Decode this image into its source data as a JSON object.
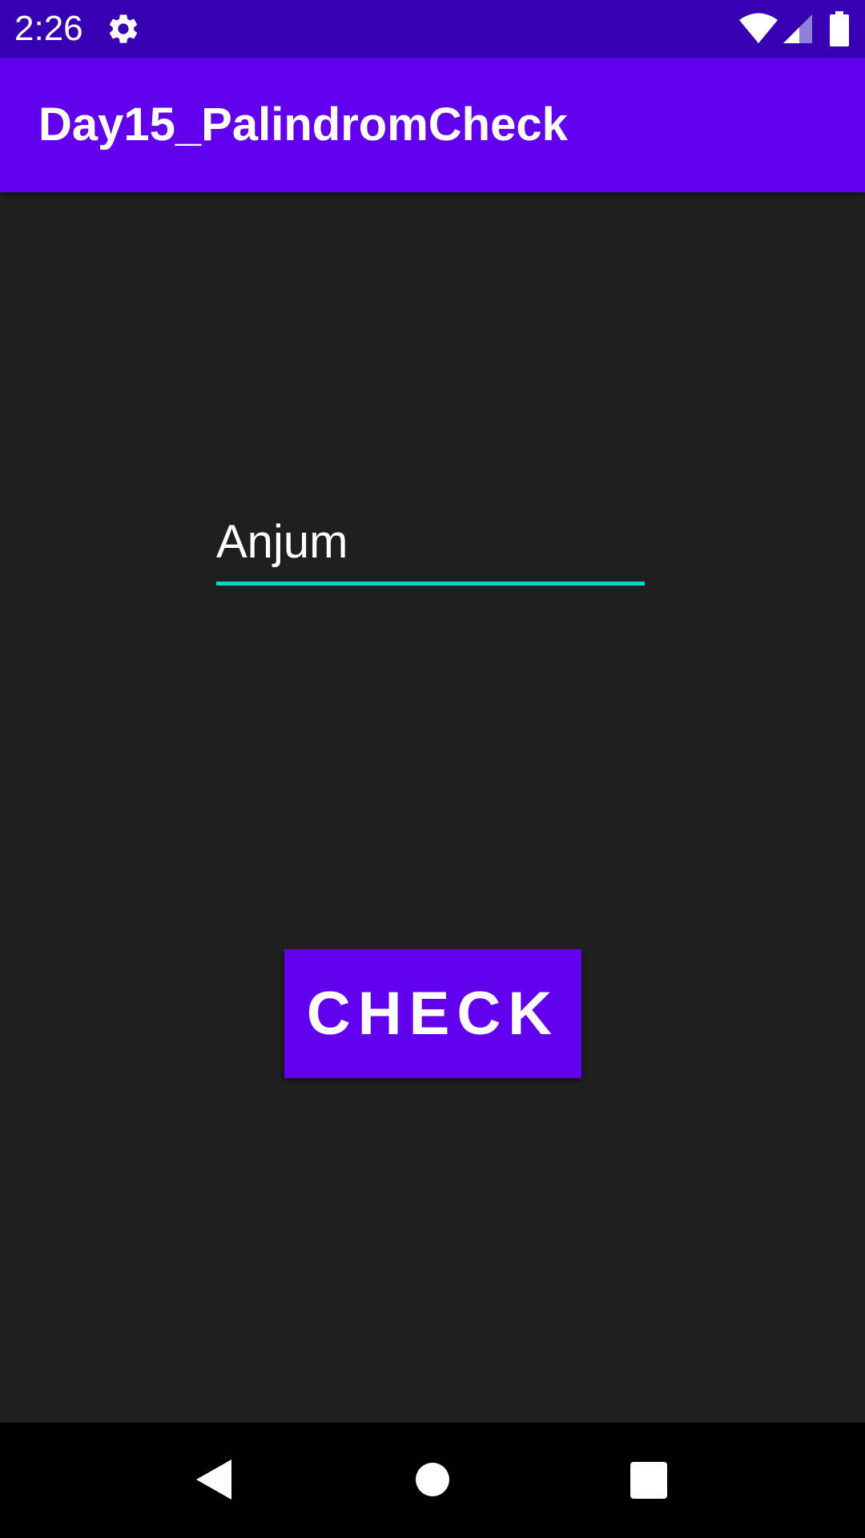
{
  "status_bar": {
    "time": "2:26",
    "icons": [
      "gear-icon",
      "wifi-icon",
      "cell-signal-icon",
      "battery-icon"
    ]
  },
  "app_bar": {
    "title": "Day15_PalindromCheck"
  },
  "main": {
    "input": {
      "value": "Anjum",
      "accent_color": "#03dac5"
    },
    "check_button": {
      "label": "CHECK"
    }
  },
  "nav_bar": {
    "icons": [
      "back-icon",
      "home-icon",
      "recents-icon"
    ]
  },
  "colors": {
    "status_bar": "#3700b3",
    "primary": "#6200ee",
    "background": "#1f1f1f",
    "accent": "#03dac5"
  }
}
